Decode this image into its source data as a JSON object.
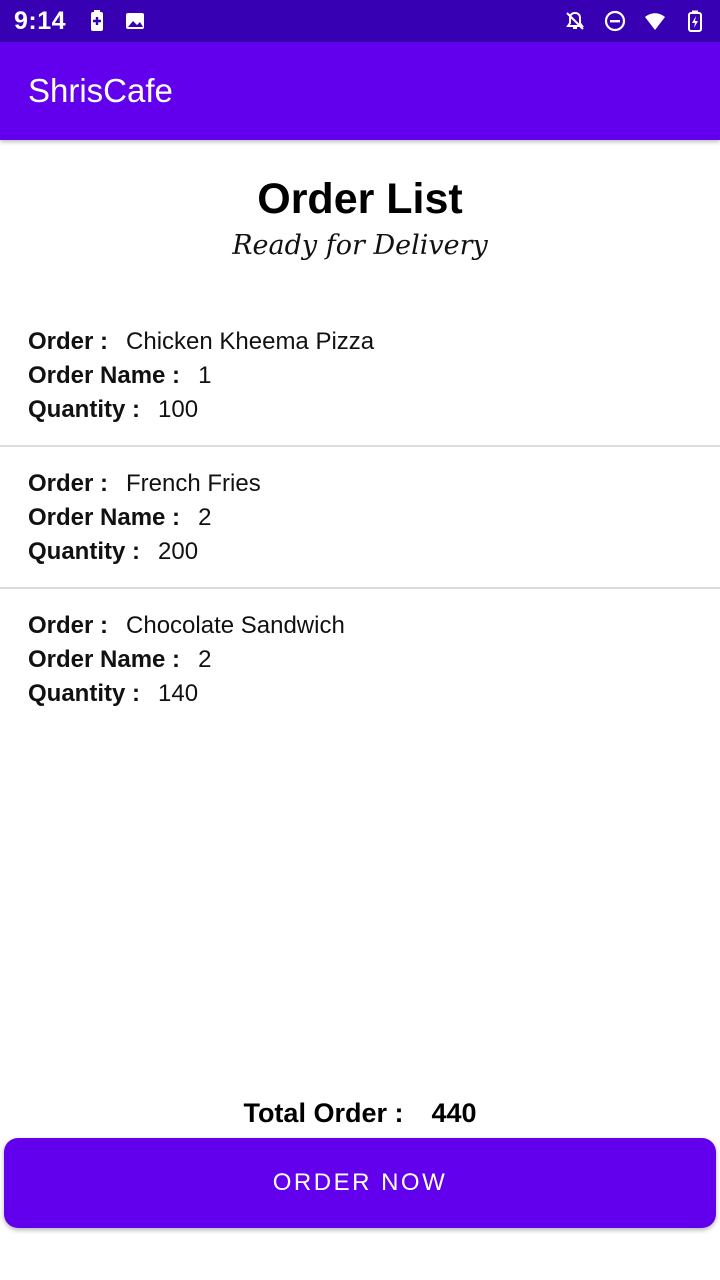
{
  "status_bar": {
    "time": "9:14",
    "icons": [
      "battery-saver-icon",
      "image-icon",
      "notifications-off-icon",
      "do-not-disturb-icon",
      "wifi-icon",
      "battery-charging-icon"
    ]
  },
  "app_bar": {
    "title": "ShrisCafe"
  },
  "page": {
    "title": "Order List",
    "subtitle": "Ready for Delivery"
  },
  "labels": {
    "order": "Order :",
    "order_name": "Order Name :",
    "quantity": "Quantity :"
  },
  "orders": [
    {
      "order": "Chicken Kheema Pizza",
      "order_name": "1",
      "quantity": "100"
    },
    {
      "order": "French Fries",
      "order_name": "2",
      "quantity": "200"
    },
    {
      "order": "Chocolate Sandwich",
      "order_name": "2",
      "quantity": "140"
    }
  ],
  "total": {
    "label": "Total Order :",
    "value": "440"
  },
  "button": {
    "label": "ORDER NOW"
  },
  "colors": {
    "primary": "#6200ee",
    "primary_dark": "#3700b3",
    "divider": "#dcdcdc"
  }
}
